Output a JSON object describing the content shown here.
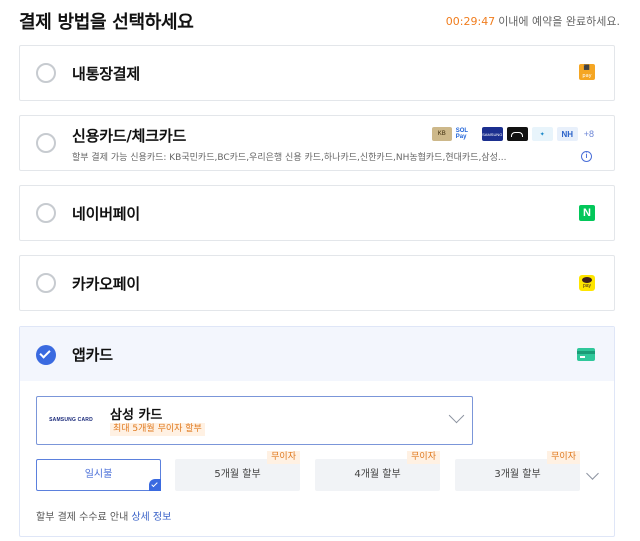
{
  "header": {
    "title": "결제 방법을 선택하세요",
    "timer": "00:29:47",
    "timer_suffix": "이내에 예약을 완료하세요."
  },
  "options": [
    {
      "label": "내통장결제",
      "icon": "naepay-icon",
      "selected": false
    },
    {
      "label": "신용카드/체크카드",
      "selected": false,
      "card_logos": [
        "KB",
        "SOL Pay",
        "SAMSUNG",
        "hyundai",
        "woori",
        "NH"
      ],
      "more_count": "+8",
      "note": "할부 결제 가능 신용카드: KB국민카드,BC카드,우리은행 신용 카드,하나카드,신한카드,NH농협카드,현대카드,삼성..."
    },
    {
      "label": "네이버페이",
      "icon": "naver-pay-icon",
      "icon_text": "N",
      "selected": false
    },
    {
      "label": "카카오페이",
      "icon": "kakao-pay-icon",
      "icon_text": "pay",
      "selected": false
    },
    {
      "label": "앱카드",
      "icon": "card-icon",
      "selected": true
    }
  ],
  "appcard": {
    "card_logo": "SAMSUNG CARD",
    "card_name": "삼성 카드",
    "promo": "최대 5개월 무이자 할부",
    "installments": [
      {
        "label": "일시불",
        "badge": "",
        "selected": true
      },
      {
        "label": "5개월 할부",
        "badge": "무이자",
        "selected": false
      },
      {
        "label": "4개월 할부",
        "badge": "무이자",
        "selected": false
      },
      {
        "label": "3개월 할부",
        "badge": "무이자",
        "selected": false
      }
    ],
    "fee_note": "할부 결제 수수료 안내",
    "fee_link": "상세 정보"
  },
  "colors": {
    "accent": "#3a6ae0",
    "timer": "#f07d1e",
    "promo_text": "#e07a20",
    "promo_bg": "#fff1e3",
    "naver_green": "#03c75a",
    "kakao_yellow": "#fee500",
    "naepay_orange": "#f5a623",
    "appcard_green": "#2fc79a"
  }
}
